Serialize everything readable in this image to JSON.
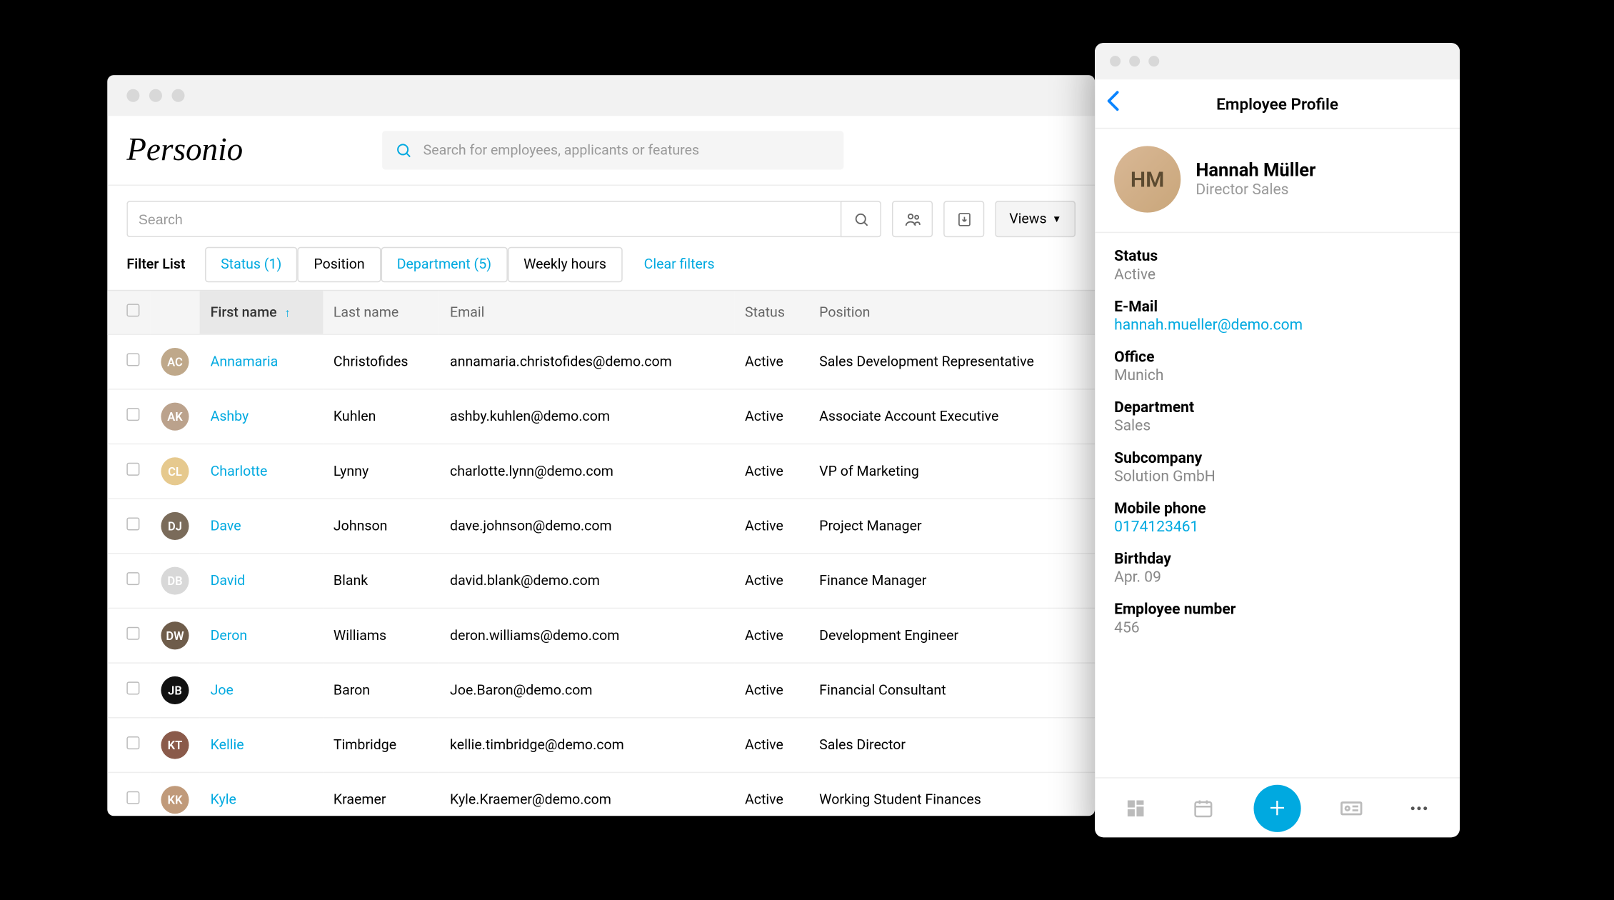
{
  "app": {
    "logo_text": "Personio"
  },
  "global_search": {
    "placeholder": "Search for employees, applicants or features"
  },
  "local_search": {
    "placeholder": "Search"
  },
  "views_button": {
    "label": "Views"
  },
  "filters": {
    "title": "Filter List",
    "chips": [
      {
        "label": "Status (1)",
        "active": true
      },
      {
        "label": "Position",
        "active": false
      },
      {
        "label": "Department (5)",
        "active": true
      },
      {
        "label": "Weekly hours",
        "active": false
      }
    ],
    "clear_label": "Clear filters"
  },
  "table": {
    "headers": {
      "first_name": "First name",
      "last_name": "Last name",
      "email": "Email",
      "status": "Status",
      "position": "Position"
    },
    "rows": [
      {
        "first": "Annamaria",
        "last": "Christofides",
        "email": "annamaria.christofides@demo.com",
        "status": "Active",
        "position": "Sales Development Representative",
        "av_bg": "#bfa88a",
        "av_txt": "AC"
      },
      {
        "first": "Ashby",
        "last": "Kuhlen",
        "email": "ashby.kuhlen@demo.com",
        "status": "Active",
        "position": "Associate Account Executive",
        "av_bg": "#bba28c",
        "av_txt": "AK"
      },
      {
        "first": "Charlotte",
        "last": "Lynny",
        "email": "charlotte.lynn@demo.com",
        "status": "Active",
        "position": "VP of Marketing",
        "av_bg": "#e6c98e",
        "av_txt": "CL"
      },
      {
        "first": "Dave",
        "last": "Johnson",
        "email": "dave.johnson@demo.com",
        "status": "Active",
        "position": "Project Manager",
        "av_bg": "#7a6b5a",
        "av_txt": "DJ"
      },
      {
        "first": "David",
        "last": "Blank",
        "email": "david.blank@demo.com",
        "status": "Active",
        "position": "Finance Manager",
        "av_bg": "#d8d8d8",
        "av_txt": "DB"
      },
      {
        "first": "Deron",
        "last": "Williams",
        "email": "deron.williams@demo.com",
        "status": "Active",
        "position": "Development Engineer",
        "av_bg": "#6e5c4a",
        "av_txt": "DW"
      },
      {
        "first": "Joe",
        "last": "Baron",
        "email": "Joe.Baron@demo.com",
        "status": "Active",
        "position": "Financial Consultant",
        "av_bg": "#111111",
        "av_txt": "JB"
      },
      {
        "first": "Kellie",
        "last": "Timbridge",
        "email": "kellie.timbridge@demo.com",
        "status": "Active",
        "position": "Sales Director",
        "av_bg": "#8a5a4a",
        "av_txt": "KT"
      },
      {
        "first": "Kyle",
        "last": "Kraemer",
        "email": "Kyle.Kraemer@demo.com",
        "status": "Active",
        "position": "Working Student Finances",
        "av_bg": "#c09a7a",
        "av_txt": "KK"
      }
    ]
  },
  "mobile": {
    "header_title": "Employee Profile",
    "name": "Hannah Müller",
    "role": "Director Sales",
    "avatar_initials": "HM",
    "fields": [
      {
        "label": "Status",
        "value": "Active",
        "link": false
      },
      {
        "label": "E-Mail",
        "value": "hannah.mueller@demo.com",
        "link": true
      },
      {
        "label": "Office",
        "value": "Munich",
        "link": false
      },
      {
        "label": "Department",
        "value": "Sales",
        "link": false
      },
      {
        "label": "Subcompany",
        "value": "Solution GmbH",
        "link": false
      },
      {
        "label": "Mobile phone",
        "value": "0174123461",
        "link": true
      },
      {
        "label": "Birthday",
        "value": "Apr. 09",
        "link": false
      },
      {
        "label": "Employee number",
        "value": "456",
        "link": false
      }
    ]
  }
}
